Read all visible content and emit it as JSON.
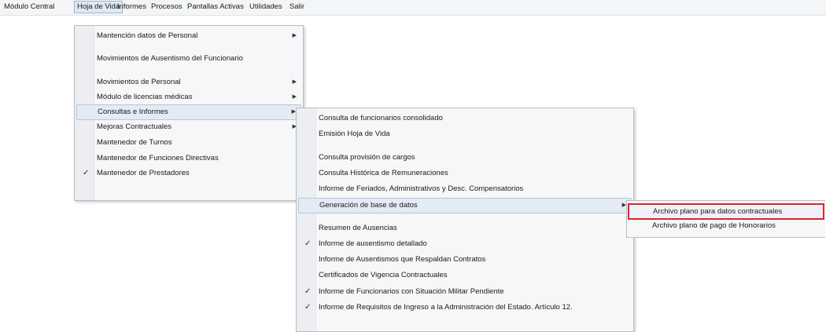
{
  "menubar": {
    "items": [
      "Módulo Central",
      "Hoja de Vida",
      "Informes",
      "Procesos",
      "Pantallas Activas",
      "Utilidades",
      "Salir"
    ]
  },
  "menu1": {
    "items": [
      {
        "label": "Mantención datos de Personal",
        "submenu": true
      },
      {
        "label": "Movimientos de Ausentismo del Funcionario"
      },
      {
        "label": "Movimientos de Personal",
        "submenu": true
      },
      {
        "label": "Módulo de licencias médicas",
        "submenu": true
      },
      {
        "label": "Consultas e Informes",
        "submenu": true
      },
      {
        "label": "Mejoras Contractuales",
        "submenu": true
      },
      {
        "label": "Mantenedor de Turnos"
      },
      {
        "label": "Mantenedor de Funciones Directivas"
      },
      {
        "label": "Mantenedor de Prestadores",
        "checked": true
      }
    ]
  },
  "menu2": {
    "items": [
      {
        "label": "Consulta de funcionarios consolidado"
      },
      {
        "label": "Emisión Hoja de Vida"
      },
      {
        "label": "Consulta provisión de cargos"
      },
      {
        "label": "Consulta Histórica de Remuneraciones"
      },
      {
        "label": "Informe de Feriados, Administrativos y Desc. Compensatorios"
      },
      {
        "label": "Generación de base de datos",
        "submenu": true
      },
      {
        "label": "Resumen de Ausencias"
      },
      {
        "label": "Informe de ausentismo detallado",
        "checked": true
      },
      {
        "label": "Informe de Ausentismos que Respaldan Contratos"
      },
      {
        "label": "Certificados de Vigencia Contractuales"
      },
      {
        "label": "Informe de Funcionarios con Situación Militar Pendiente",
        "checked": true
      },
      {
        "label": "Informe de Requisitos de Ingreso a la Administración del Estado. Artículo 12.",
        "checked": true
      }
    ]
  },
  "menu3": {
    "items": [
      {
        "label": "Archivo plano para datos contractuales"
      },
      {
        "label": "Archivo plano de pago de Honorarios"
      }
    ]
  },
  "glyphs": {
    "check": "✓",
    "arrow": "▶"
  },
  "colors": {
    "highlight_border": "#e0242d",
    "hover_bg": "#e4ebf4"
  }
}
